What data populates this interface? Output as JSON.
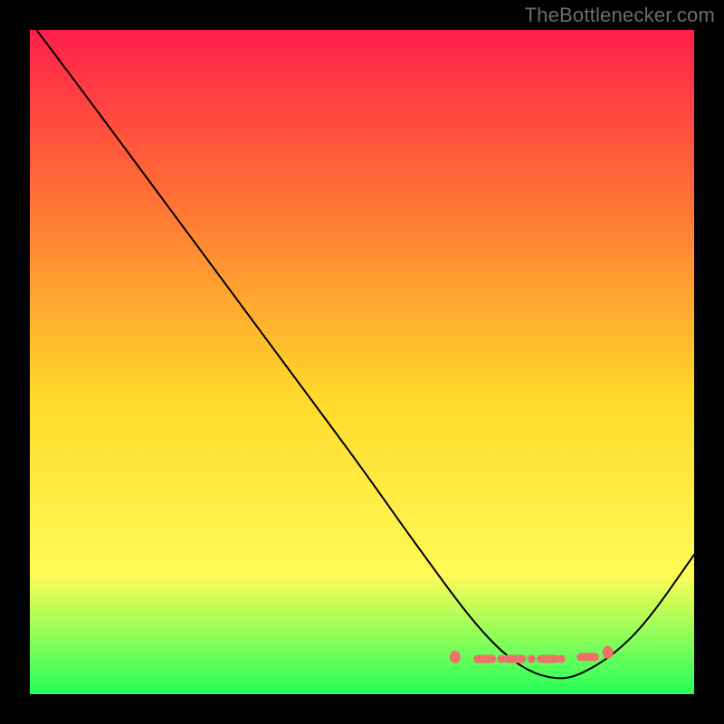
{
  "attribution": "TheBottlenecker.com",
  "chart_data": {
    "type": "line",
    "title": "",
    "xlabel": "",
    "ylabel": "",
    "xlim": [
      0,
      100
    ],
    "ylim": [
      0,
      100
    ],
    "series": [
      {
        "name": "bottleneck-curve",
        "x": [
          1,
          4,
          10,
          20,
          30,
          40,
          50,
          56,
          60,
          64,
          68,
          72,
          76,
          80,
          83,
          88,
          93,
          100
        ],
        "y": [
          100,
          96,
          88,
          74.5,
          61,
          47.5,
          34,
          25.5,
          20,
          14.5,
          9.5,
          5.5,
          3,
          2.2,
          3,
          6,
          11,
          21
        ]
      }
    ],
    "markers": {
      "name": "bottleneck-sweet-spot",
      "shape": "dash-dot-cluster",
      "x": [
        64,
        68.5,
        71,
        73,
        75.5,
        78,
        80,
        84,
        87
      ],
      "y": [
        5.6,
        5.3,
        5.3,
        5.3,
        5.3,
        5.3,
        5.3,
        5.6,
        6.3
      ]
    }
  },
  "colors": {
    "gradient_top": "#ff1f4a",
    "gradient_upper_mid": "#ff7a33",
    "gradient_mid": "#ffd92b",
    "gradient_lower_mid": "#fffb57",
    "gradient_bottom": "#25ff5b",
    "marker": "#ed7268",
    "attribution": "#6d6d6d",
    "frame": "#000000"
  }
}
